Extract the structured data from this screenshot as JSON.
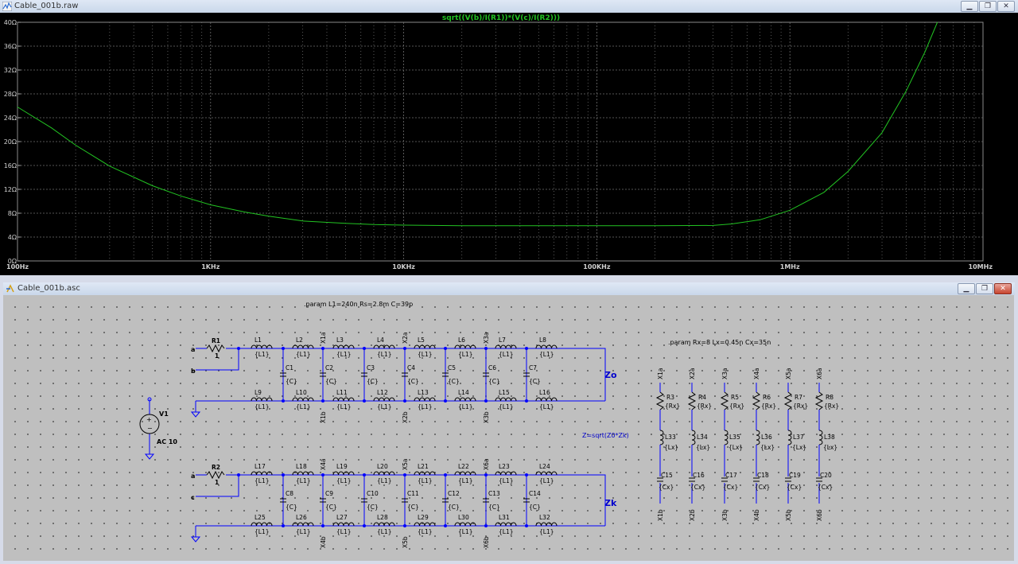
{
  "plot_window": {
    "title": "Cable_001b.raw",
    "trace_expression": "sqrt((V(b)/I(R1))*(V(c)/I(R2)))",
    "trace_color": "#22c322",
    "buttons": [
      "minimize",
      "maximize",
      "close"
    ]
  },
  "chart_data": {
    "type": "line",
    "title": "sqrt((V(b)/I(R1))*(V(c)/I(R2)))",
    "xscale": "log",
    "xlim": [
      100,
      10000000
    ],
    "ylim": [
      0,
      40
    ],
    "xticks": [
      "100Hz",
      "1KHz",
      "10KHz",
      "100KHz",
      "1MHz",
      "10MHz"
    ],
    "yticks": [
      "0Ω",
      "4Ω",
      "8Ω",
      "12Ω",
      "16Ω",
      "20Ω",
      "24Ω",
      "28Ω",
      "32Ω",
      "36Ω",
      "40Ω"
    ],
    "grid": true,
    "series": [
      {
        "name": "sqrt((V(b)/I(R1))*(V(c)/I(R2)))",
        "x": [
          100,
          150,
          200,
          300,
          500,
          700,
          1000,
          1500,
          2000,
          3000,
          5000,
          7000,
          10000,
          20000,
          50000,
          100000,
          200000,
          400000,
          500000,
          700000,
          1000000,
          1500000,
          2000000,
          3000000,
          4000000,
          5000000,
          5800000
        ],
        "y": [
          25.8,
          22.3,
          19.4,
          15.9,
          12.6,
          10.9,
          9.4,
          8.2,
          7.5,
          6.7,
          6.3,
          6.1,
          6.0,
          5.9,
          5.9,
          5.9,
          5.9,
          5.95,
          6.2,
          6.9,
          8.5,
          11.5,
          15.0,
          21.5,
          28.5,
          35.0,
          40.0
        ]
      }
    ]
  },
  "schematic_window": {
    "title": "Cable_001b.asc",
    "buttons": [
      "minimize",
      "maximize",
      "close"
    ],
    "directives": {
      "param1": ".param L1=240n Rs=2.8m C=39p",
      "param2": ".param Rx=8 Lx=0.45n Cx=35n",
      "formula": "Z=sqrt(Z0*Zk)"
    },
    "source": {
      "name": "V1",
      "value": "AC 10"
    },
    "labels": {
      "zo": "Zo",
      "zk": "Zk"
    },
    "resistors": {
      "r1": {
        "name": "R1",
        "value": "1"
      },
      "r2": {
        "name": "R2",
        "value": "1"
      }
    },
    "nets": {
      "a1": "a",
      "b": "b",
      "a2": "a",
      "c": "c"
    },
    "top_series": [
      "L1",
      "L2",
      "L3",
      "L4",
      "L5",
      "L6",
      "L7",
      "L8"
    ],
    "top_return": [
      "L9",
      "L10",
      "L11",
      "L12",
      "L13",
      "L14",
      "L15",
      "L16"
    ],
    "top_caps": [
      "C1",
      "C2",
      "C3",
      "C4",
      "C5",
      "C6",
      "C7"
    ],
    "bot_series": [
      "L17",
      "L18",
      "L19",
      "L20",
      "L21",
      "L22",
      "L23",
      "L24"
    ],
    "bot_return": [
      "L25",
      "L26",
      "L27",
      "L28",
      "L29",
      "L30",
      "L31",
      "L32"
    ],
    "bot_caps": [
      "C8",
      "C9",
      "C10",
      "C11",
      "C12",
      "C13",
      "C14"
    ],
    "inductor_value": "{L1}",
    "cap_value": "{C}",
    "taps_top": [
      "X1a",
      "X2a",
      "X3a"
    ],
    "taps_top_b": [
      "X1b",
      "X2b",
      "X3b"
    ],
    "taps_bot": [
      "X4a",
      "X5a",
      "X6a"
    ],
    "taps_bot_b": [
      "X4b",
      "X5b",
      "X6b"
    ],
    "ladder_top": [
      "X1a",
      "X2a",
      "X3a",
      "X4a",
      "X5a",
      "X6a"
    ],
    "ladder_res": [
      "R3",
      "R4",
      "R5",
      "R6",
      "R7",
      "R8"
    ],
    "ladder_ind": [
      "L33",
      "L34",
      "L35",
      "L36",
      "L37",
      "L38"
    ],
    "ladder_cap": [
      "C15",
      "C16",
      "C17",
      "C18",
      "C19",
      "C20"
    ],
    "ladder_bot": [
      "X1b",
      "X2b",
      "X3b",
      "X4b",
      "X5b",
      "X6b"
    ],
    "ladder_values": {
      "res": "{Rx}",
      "ind": "{Lx}",
      "cap": "{Cx}"
    }
  }
}
